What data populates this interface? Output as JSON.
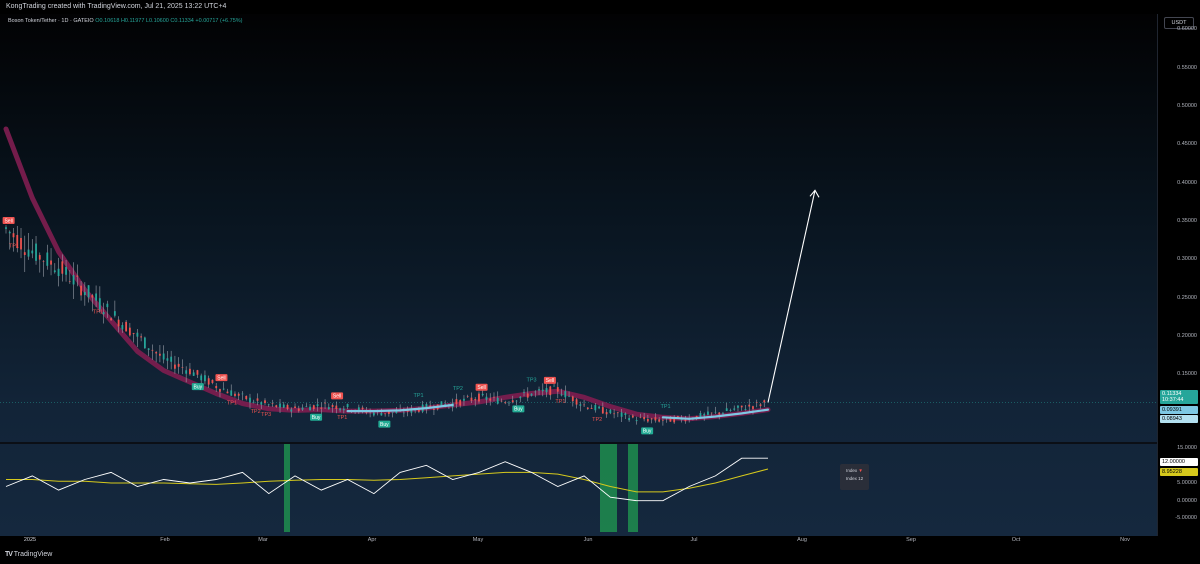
{
  "header": {
    "caption": "KongTrading created with TradingView.com, Jul 21, 2025 13:22 UTC+4"
  },
  "legend": {
    "symbol": "Boson Token/Tether · 1D · GATEIO",
    "open": "O0.10618",
    "high": "H0.11977",
    "low": "L0.10600",
    "close": "C0.11334",
    "change": "+0.00717 (+6.75%)"
  },
  "price_axis": {
    "currency": "USDT",
    "ticks": [
      "0.60000",
      "0.55000",
      "0.50000",
      "0.45000",
      "0.40000",
      "0.35000",
      "0.30000",
      "0.25000",
      "0.20000",
      "0.15000",
      "0.10000"
    ],
    "current_price": "0.11334",
    "countdown": "10:37:44",
    "tag_blue_1": "0.09391",
    "tag_blue_2": "0.08943"
  },
  "indicator_axis": {
    "ticks": [
      "15.0000",
      "5.00000",
      "0.00000",
      "-5.00000"
    ],
    "tag_white": "12.00000",
    "tag_yellow": "8.95228"
  },
  "time_axis": [
    "2025",
    "Feb",
    "Mar",
    "Apr",
    "May",
    "Jun",
    "Jul",
    "Aug",
    "Sep",
    "Oct",
    "Nov"
  ],
  "signals": [
    {
      "label": "Sell",
      "kind": "sell"
    },
    {
      "label": "TP1",
      "kind": "tpsell"
    },
    {
      "label": "TP1",
      "kind": "tpsell"
    },
    {
      "label": "Buy",
      "kind": "buy"
    },
    {
      "label": "Sell",
      "kind": "sell"
    },
    {
      "label": "TP1",
      "kind": "tpsell"
    },
    {
      "label": "TP2",
      "kind": "tpsell"
    },
    {
      "label": "TP3",
      "kind": "tpsell"
    },
    {
      "label": "Buy",
      "kind": "buy"
    },
    {
      "label": "Sell",
      "kind": "sell"
    },
    {
      "label": "TP1",
      "kind": "tpsell"
    },
    {
      "label": "Buy",
      "kind": "buy"
    },
    {
      "label": "TP1",
      "kind": "tpbuy"
    },
    {
      "label": "TP2",
      "kind": "tpbuy"
    },
    {
      "label": "Sell",
      "kind": "sell"
    },
    {
      "label": "Buy",
      "kind": "buy"
    },
    {
      "label": "TP3",
      "kind": "tpbuy"
    },
    {
      "label": "Sell",
      "kind": "sell"
    },
    {
      "label": "TP1",
      "kind": "tpsell"
    },
    {
      "label": "TP2",
      "kind": "tpsell"
    },
    {
      "label": "Buy",
      "kind": "buy"
    },
    {
      "label": "TP1",
      "kind": "tpbuy"
    }
  ],
  "tooltip": {
    "title": "Index",
    "arrow": "▼",
    "body": "Index 12"
  },
  "footer": {
    "brand": "TradingView"
  },
  "colors": {
    "background": "#000000",
    "chart_gradient_bottom": "#15283e",
    "bull": "#26a69a",
    "bear": "#ef5350",
    "sell_badge": "#ef5350",
    "buy_badge": "#22ab94",
    "ribbon_bear": "#7a1d4e",
    "ribbon_bull": "#7ec8e3",
    "oscillator": "#ffffff",
    "signal_line": "#d6c91c",
    "volume_bar": "#1e8e4f"
  },
  "chart_data": {
    "type": "candlestick",
    "x": [
      "2025-01-01",
      "2025-01-08",
      "2025-01-15",
      "2025-01-22",
      "2025-01-29",
      "2025-02-05",
      "2025-02-12",
      "2025-02-19",
      "2025-02-26",
      "2025-03-05",
      "2025-03-12",
      "2025-03-19",
      "2025-03-26",
      "2025-04-02",
      "2025-04-09",
      "2025-04-16",
      "2025-04-23",
      "2025-04-30",
      "2025-05-07",
      "2025-05-14",
      "2025-05-21",
      "2025-05-28",
      "2025-06-04",
      "2025-06-11",
      "2025-06-18",
      "2025-06-25",
      "2025-07-02",
      "2025-07-09",
      "2025-07-16",
      "2025-07-21"
    ],
    "close": [
      0.34,
      0.31,
      0.29,
      0.26,
      0.23,
      0.2,
      0.17,
      0.155,
      0.135,
      0.12,
      0.11,
      0.105,
      0.11,
      0.107,
      0.1,
      0.1,
      0.107,
      0.112,
      0.12,
      0.115,
      0.125,
      0.13,
      0.11,
      0.1,
      0.092,
      0.09,
      0.093,
      0.099,
      0.106,
      0.11334
    ],
    "ribbon": [
      0.47,
      0.38,
      0.31,
      0.26,
      0.22,
      0.18,
      0.155,
      0.14,
      0.125,
      0.112,
      0.105,
      0.103,
      0.104,
      0.102,
      0.102,
      0.103,
      0.106,
      0.11,
      0.114,
      0.12,
      0.125,
      0.128,
      0.12,
      0.108,
      0.098,
      0.094,
      0.092,
      0.095,
      0.099,
      0.104
    ],
    "projection": {
      "from": 0.11334,
      "to": 0.39,
      "label_date": "2025-08-03"
    },
    "oscillator": [
      4,
      7,
      3,
      6,
      8,
      4,
      6,
      5,
      6,
      8,
      2,
      7,
      3,
      6,
      2,
      8,
      10,
      6,
      8,
      11,
      8,
      4,
      7,
      1,
      0,
      0,
      4,
      7,
      12,
      12
    ],
    "oscillator_signal": [
      6,
      6,
      5.5,
      5.5,
      5,
      5,
      5,
      4.8,
      4.6,
      5,
      5.5,
      5.8,
      6,
      6,
      5.8,
      6,
      6.5,
      7,
      7.5,
      8,
      8,
      7.5,
      6,
      4,
      2.5,
      2.5,
      3.5,
      5,
      7,
      8.95
    ],
    "price_ylim": [
      0.08,
      0.62
    ],
    "osc_ylim": [
      -6,
      16
    ]
  }
}
